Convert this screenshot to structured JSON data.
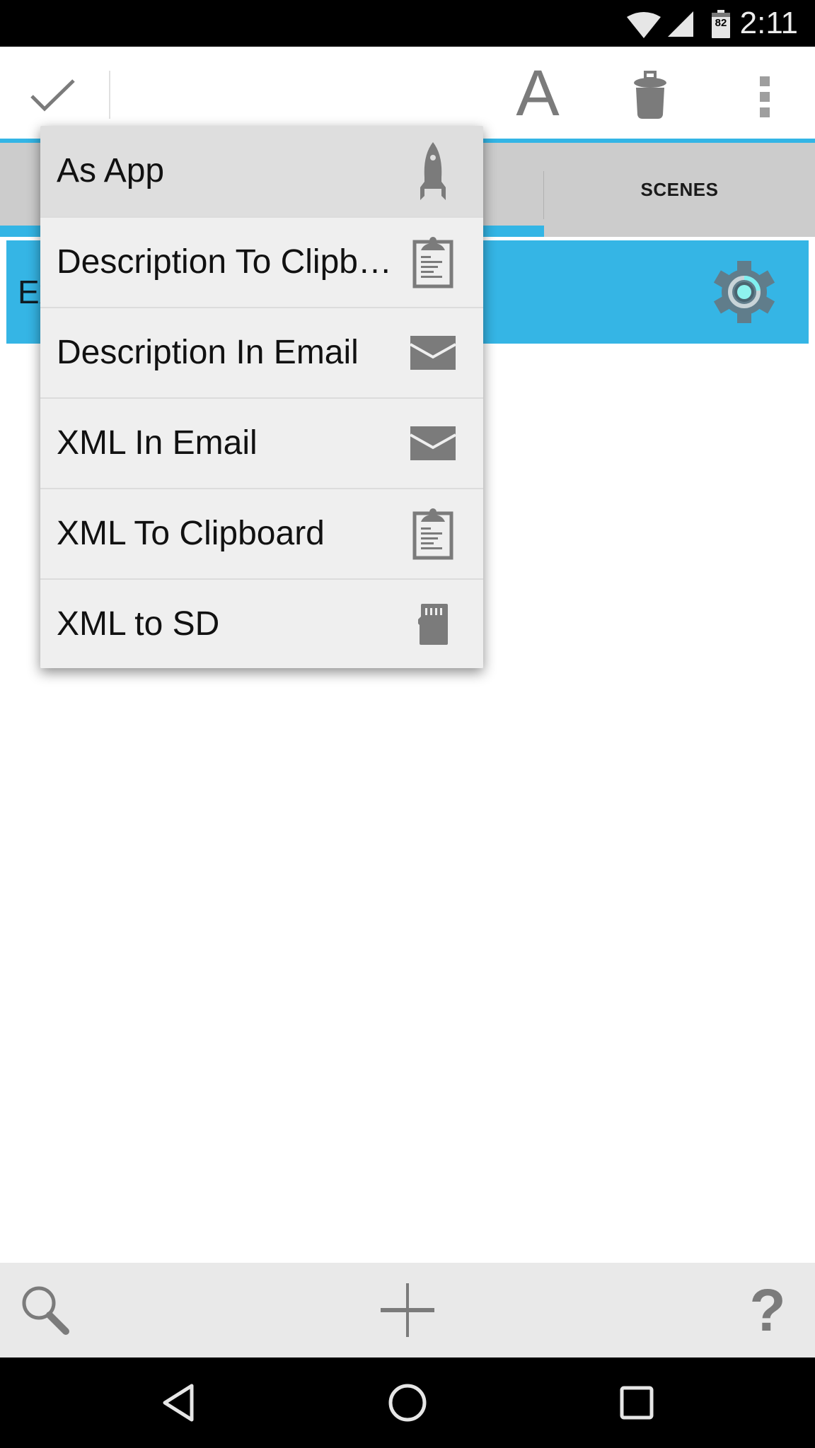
{
  "status_bar": {
    "time": "2:11",
    "battery_level": "82",
    "icons": [
      "wifi-icon",
      "cell-signal-icon",
      "battery-icon"
    ]
  },
  "toolbar": {
    "done_icon": "checkmark-icon",
    "actions": [
      {
        "name": "text-format",
        "icon": "letter-a-icon",
        "glyph": "A"
      },
      {
        "name": "delete",
        "icon": "trash-icon"
      },
      {
        "name": "overflow",
        "icon": "more-vert-icon"
      }
    ]
  },
  "tabs": {
    "items": [
      {
        "label": "",
        "selected": true
      },
      {
        "label": "SCENES",
        "selected": false
      }
    ]
  },
  "list": {
    "rows": [
      {
        "name": "Ex",
        "icon": "gear-icon"
      }
    ]
  },
  "export_menu": {
    "items": [
      {
        "label": "As App",
        "icon": "rocket-icon",
        "highlighted": true
      },
      {
        "label": "Description To Clipb…",
        "icon": "clipboard-icon"
      },
      {
        "label": "Description In Email",
        "icon": "email-icon"
      },
      {
        "label": "XML In Email",
        "icon": "email-icon"
      },
      {
        "label": "XML To Clipboard",
        "icon": "clipboard-icon"
      },
      {
        "label": "XML to SD",
        "icon": "sd-card-icon"
      }
    ]
  },
  "bottom_bar": {
    "buttons": [
      {
        "name": "search",
        "icon": "search-icon"
      },
      {
        "name": "add",
        "icon": "plus-icon"
      },
      {
        "name": "help",
        "icon": "help-icon",
        "glyph": "?"
      }
    ]
  },
  "nav_bar": {
    "buttons": [
      "back",
      "home",
      "recents"
    ]
  },
  "colors": {
    "accent": "#33b5e5",
    "row_selected": "#35b5e5",
    "tab_bar": "#cccccc",
    "menu_bg": "#efefef",
    "menu_highlight": "#dedede",
    "icon_gray": "#7b7b7b",
    "bottom_bar": "#e9e9e9"
  }
}
